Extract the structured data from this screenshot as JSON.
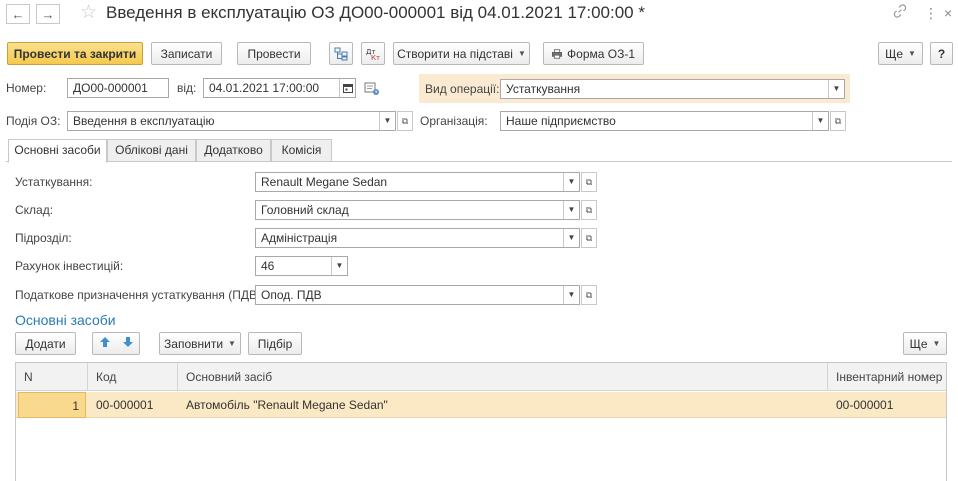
{
  "window": {
    "title": "Введення в експлуатацію ОЗ ДО00-000001 від 04.01.2021 17:00:00 *",
    "back_glyph": "←",
    "forward_glyph": "→",
    "star_glyph": "☆",
    "link_glyph": "🔗",
    "more_glyph": "⋮",
    "close_glyph": "×"
  },
  "toolbar": {
    "post_close": "Провести та закрити",
    "save": "Записати",
    "post": "Провести",
    "create_based": "Створити на підставі",
    "print_form": "Форма ОЗ-1",
    "more": "Ще",
    "help": "?"
  },
  "header": {
    "number_label": "Номер:",
    "number_value": "ДО00-000001",
    "date_label": "від:",
    "date_value": "04.01.2021 17:00:00",
    "operation_label": "Вид операції:",
    "operation_value": "Устаткування",
    "event_label": "Подія ОЗ:",
    "event_value": "Введення в експлуатацію",
    "org_label": "Організація:",
    "org_value": "Наше підприємство"
  },
  "tabs": [
    {
      "label": "Основні засоби"
    },
    {
      "label": "Облікові дані"
    },
    {
      "label": "Додатково"
    },
    {
      "label": "Комісія"
    }
  ],
  "form": {
    "equipment_label": "Устаткування:",
    "equipment_value": "Renault Megane Sedan",
    "warehouse_label": "Склад:",
    "warehouse_value": "Головний склад",
    "division_label": "Підрозділ:",
    "division_value": "Адміністрація",
    "account_label": "Рахунок інвестицій:",
    "account_value": "46",
    "tax_label": "Податкове призначення устаткування (ПДВ):",
    "tax_value": "Опод. ПДВ"
  },
  "assets": {
    "section_title": "Основні засоби",
    "add": "Додати",
    "fill": "Заповнити",
    "pick": "Підбір",
    "more": "Ще",
    "columns": [
      "N",
      "Код",
      "Основний засіб",
      "Інвентарний номер"
    ],
    "rows": [
      {
        "n": "1",
        "code": "00-000001",
        "asset": "Автомобіль \"Renault Megane Sedan\"",
        "inventory": "00-000001"
      }
    ]
  },
  "colors": {
    "accent": "#f5c94c",
    "section_title": "#2a7ab3",
    "selected_row": "#fbe8c4",
    "operation_highlight": "#fbead2"
  }
}
